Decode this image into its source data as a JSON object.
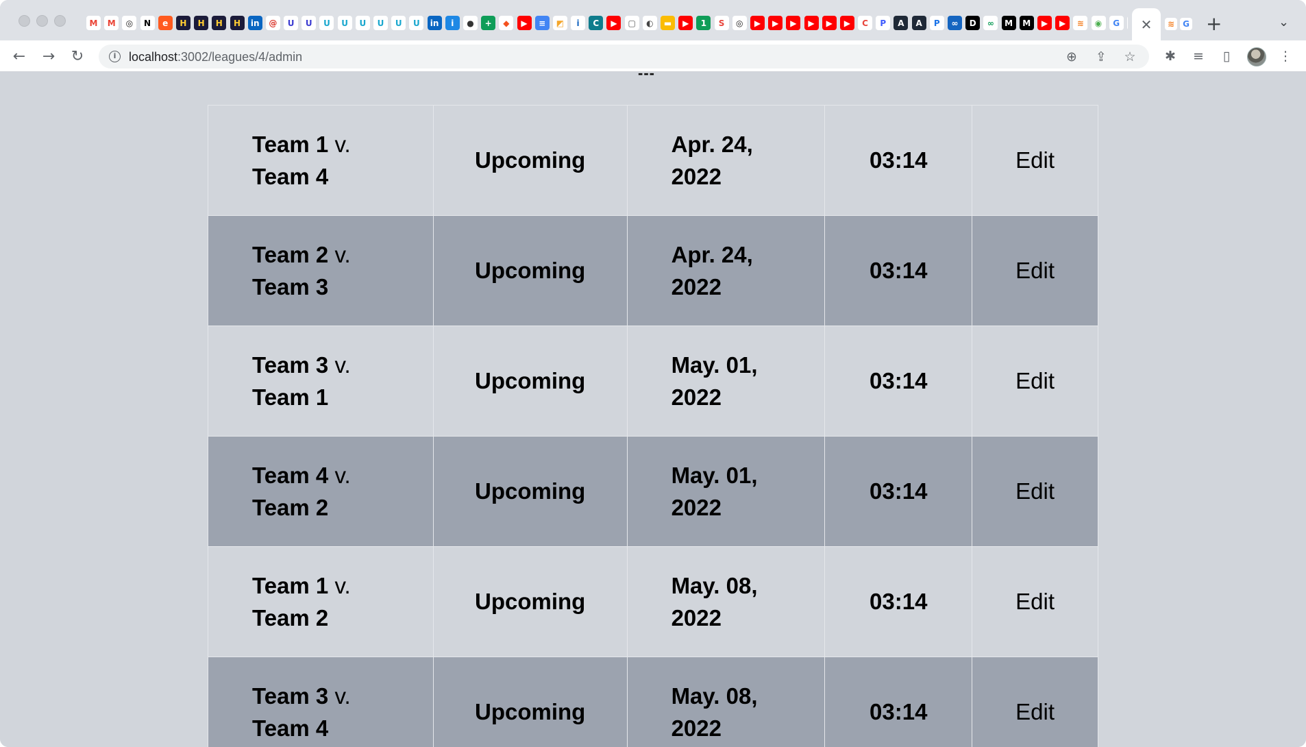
{
  "browser": {
    "url_host": "localhost",
    "url_path": ":3002/leagues/4/admin",
    "favicons": [
      {
        "glyph": "M",
        "bg": "#ffffff",
        "fg": "#ea4335"
      },
      {
        "glyph": "M",
        "bg": "#ffffff",
        "fg": "#ea4335"
      },
      {
        "glyph": "◎",
        "bg": "#ffffff",
        "fg": "#181717"
      },
      {
        "glyph": "N",
        "bg": "#ffffff",
        "fg": "#000000"
      },
      {
        "glyph": "e",
        "bg": "#ff5a1f",
        "fg": "#ffffff"
      },
      {
        "glyph": "H",
        "bg": "#1b1b3a",
        "fg": "#ffcc33"
      },
      {
        "glyph": "H",
        "bg": "#1b1b3a",
        "fg": "#ffcc33"
      },
      {
        "glyph": "H",
        "bg": "#1b1b3a",
        "fg": "#ffcc33"
      },
      {
        "glyph": "H",
        "bg": "#1b1b3a",
        "fg": "#ffcc33"
      },
      {
        "glyph": "in",
        "bg": "#0a66c2",
        "fg": "#ffffff"
      },
      {
        "glyph": "@",
        "bg": "#ffffff",
        "fg": "#d93025"
      },
      {
        "glyph": "U",
        "bg": "#ffffff",
        "fg": "#3b3bd1"
      },
      {
        "glyph": "U",
        "bg": "#ffffff",
        "fg": "#3b3bd1"
      },
      {
        "glyph": "U",
        "bg": "#ffffff",
        "fg": "#19a7ce"
      },
      {
        "glyph": "U",
        "bg": "#ffffff",
        "fg": "#19a7ce"
      },
      {
        "glyph": "U",
        "bg": "#ffffff",
        "fg": "#19a7ce"
      },
      {
        "glyph": "U",
        "bg": "#ffffff",
        "fg": "#19a7ce"
      },
      {
        "glyph": "U",
        "bg": "#ffffff",
        "fg": "#19a7ce"
      },
      {
        "glyph": "U",
        "bg": "#ffffff",
        "fg": "#19a7ce"
      },
      {
        "glyph": "in",
        "bg": "#0a66c2",
        "fg": "#ffffff"
      },
      {
        "glyph": "i",
        "bg": "#1e88e5",
        "fg": "#ffffff"
      },
      {
        "glyph": "●",
        "bg": "#ffffff",
        "fg": "#333333"
      },
      {
        "glyph": "+",
        "bg": "#0f9d58",
        "fg": "#ffffff"
      },
      {
        "glyph": "◆",
        "bg": "#ffffff",
        "fg": "#f4511e"
      },
      {
        "glyph": "▶",
        "bg": "#ff0000",
        "fg": "#ffffff"
      },
      {
        "glyph": "≡",
        "bg": "#4285f4",
        "fg": "#ffffff"
      },
      {
        "glyph": "◩",
        "bg": "#ffffff",
        "fg": "#f4a62a"
      },
      {
        "glyph": "i",
        "bg": "#ffffff",
        "fg": "#1565c0"
      },
      {
        "glyph": "C",
        "bg": "#0f7c8c",
        "fg": "#ffffff"
      },
      {
        "glyph": "▶",
        "bg": "#ff0000",
        "fg": "#ffffff"
      },
      {
        "glyph": "▢",
        "bg": "#ffffff",
        "fg": "#555555"
      },
      {
        "glyph": "◐",
        "bg": "#ffffff",
        "fg": "#444444"
      },
      {
        "glyph": "▬",
        "bg": "#fbbc04",
        "fg": "#ffffff"
      },
      {
        "glyph": "▶",
        "bg": "#ff0000",
        "fg": "#ffffff"
      },
      {
        "glyph": "1",
        "bg": "#0f9d58",
        "fg": "#ffffff"
      },
      {
        "glyph": "S",
        "bg": "#ffffff",
        "fg": "#e8453c"
      },
      {
        "glyph": "◎",
        "bg": "#ffffff",
        "fg": "#181717"
      },
      {
        "glyph": "▶",
        "bg": "#ff0000",
        "fg": "#ffffff"
      },
      {
        "glyph": "▶",
        "bg": "#ff0000",
        "fg": "#ffffff"
      },
      {
        "glyph": "▶",
        "bg": "#ff0000",
        "fg": "#ffffff"
      },
      {
        "glyph": "▶",
        "bg": "#ff0000",
        "fg": "#ffffff"
      },
      {
        "glyph": "▶",
        "bg": "#ff0000",
        "fg": "#ffffff"
      },
      {
        "glyph": "▶",
        "bg": "#ff0000",
        "fg": "#ffffff"
      },
      {
        "glyph": "C",
        "bg": "#ffffff",
        "fg": "#e8453c"
      },
      {
        "glyph": "P",
        "bg": "#ffffff",
        "fg": "#3d5afe"
      },
      {
        "glyph": "A",
        "bg": "#1f2937",
        "fg": "#ffffff"
      },
      {
        "glyph": "A",
        "bg": "#1f2937",
        "fg": "#ffffff"
      },
      {
        "glyph": "P",
        "bg": "#ffffff",
        "fg": "#1a73e8"
      },
      {
        "glyph": "∞",
        "bg": "#1565c0",
        "fg": "#ffffff"
      },
      {
        "glyph": "D",
        "bg": "#000000",
        "fg": "#ffffff"
      },
      {
        "glyph": "∞",
        "bg": "#ffffff",
        "fg": "#0f9d58"
      },
      {
        "glyph": "M",
        "bg": "#000000",
        "fg": "#ffffff"
      },
      {
        "glyph": "M",
        "bg": "#000000",
        "fg": "#ffffff"
      },
      {
        "glyph": "▶",
        "bg": "#ff0000",
        "fg": "#ffffff"
      },
      {
        "glyph": "▶",
        "bg": "#ff0000",
        "fg": "#ffffff"
      },
      {
        "glyph": "≋",
        "bg": "#ffffff",
        "fg": "#f48024"
      },
      {
        "glyph": "◉",
        "bg": "#ffffff",
        "fg": "#4caf50"
      },
      {
        "glyph": "G",
        "bg": "#ffffff",
        "fg": "#4285f4"
      },
      {
        "glyph": "◎",
        "bg": "#ffffff",
        "fg": "#181717"
      }
    ],
    "after_tabs": [
      {
        "glyph": "≋",
        "bg": "#ffffff",
        "fg": "#f48024"
      },
      {
        "glyph": "G",
        "bg": "#ffffff",
        "fg": "#4285f4"
      }
    ]
  },
  "page": {
    "heading_fragment": "---"
  },
  "games": [
    {
      "home": "Team 1",
      "vs": "v.",
      "away": "Team 4",
      "status": "Upcoming",
      "date_line1": "Apr. 24,",
      "date_line2": "2022",
      "time": "03:14",
      "action": "Edit"
    },
    {
      "home": "Team 2",
      "vs": "v.",
      "away": "Team 3",
      "status": "Upcoming",
      "date_line1": "Apr. 24,",
      "date_line2": "2022",
      "time": "03:14",
      "action": "Edit"
    },
    {
      "home": "Team 3",
      "vs": "v.",
      "away": "Team 1",
      "status": "Upcoming",
      "date_line1": "May. 01,",
      "date_line2": "2022",
      "time": "03:14",
      "action": "Edit"
    },
    {
      "home": "Team 4",
      "vs": "v.",
      "away": "Team 2",
      "status": "Upcoming",
      "date_line1": "May. 01,",
      "date_line2": "2022",
      "time": "03:14",
      "action": "Edit"
    },
    {
      "home": "Team 1",
      "vs": "v.",
      "away": "Team 2",
      "status": "Upcoming",
      "date_line1": "May. 08,",
      "date_line2": "2022",
      "time": "03:14",
      "action": "Edit"
    },
    {
      "home": "Team 3",
      "vs": "v.",
      "away": "Team 4",
      "status": "Upcoming",
      "date_line1": "May. 08,",
      "date_line2": "2022",
      "time": "03:14",
      "action": "Edit"
    }
  ]
}
